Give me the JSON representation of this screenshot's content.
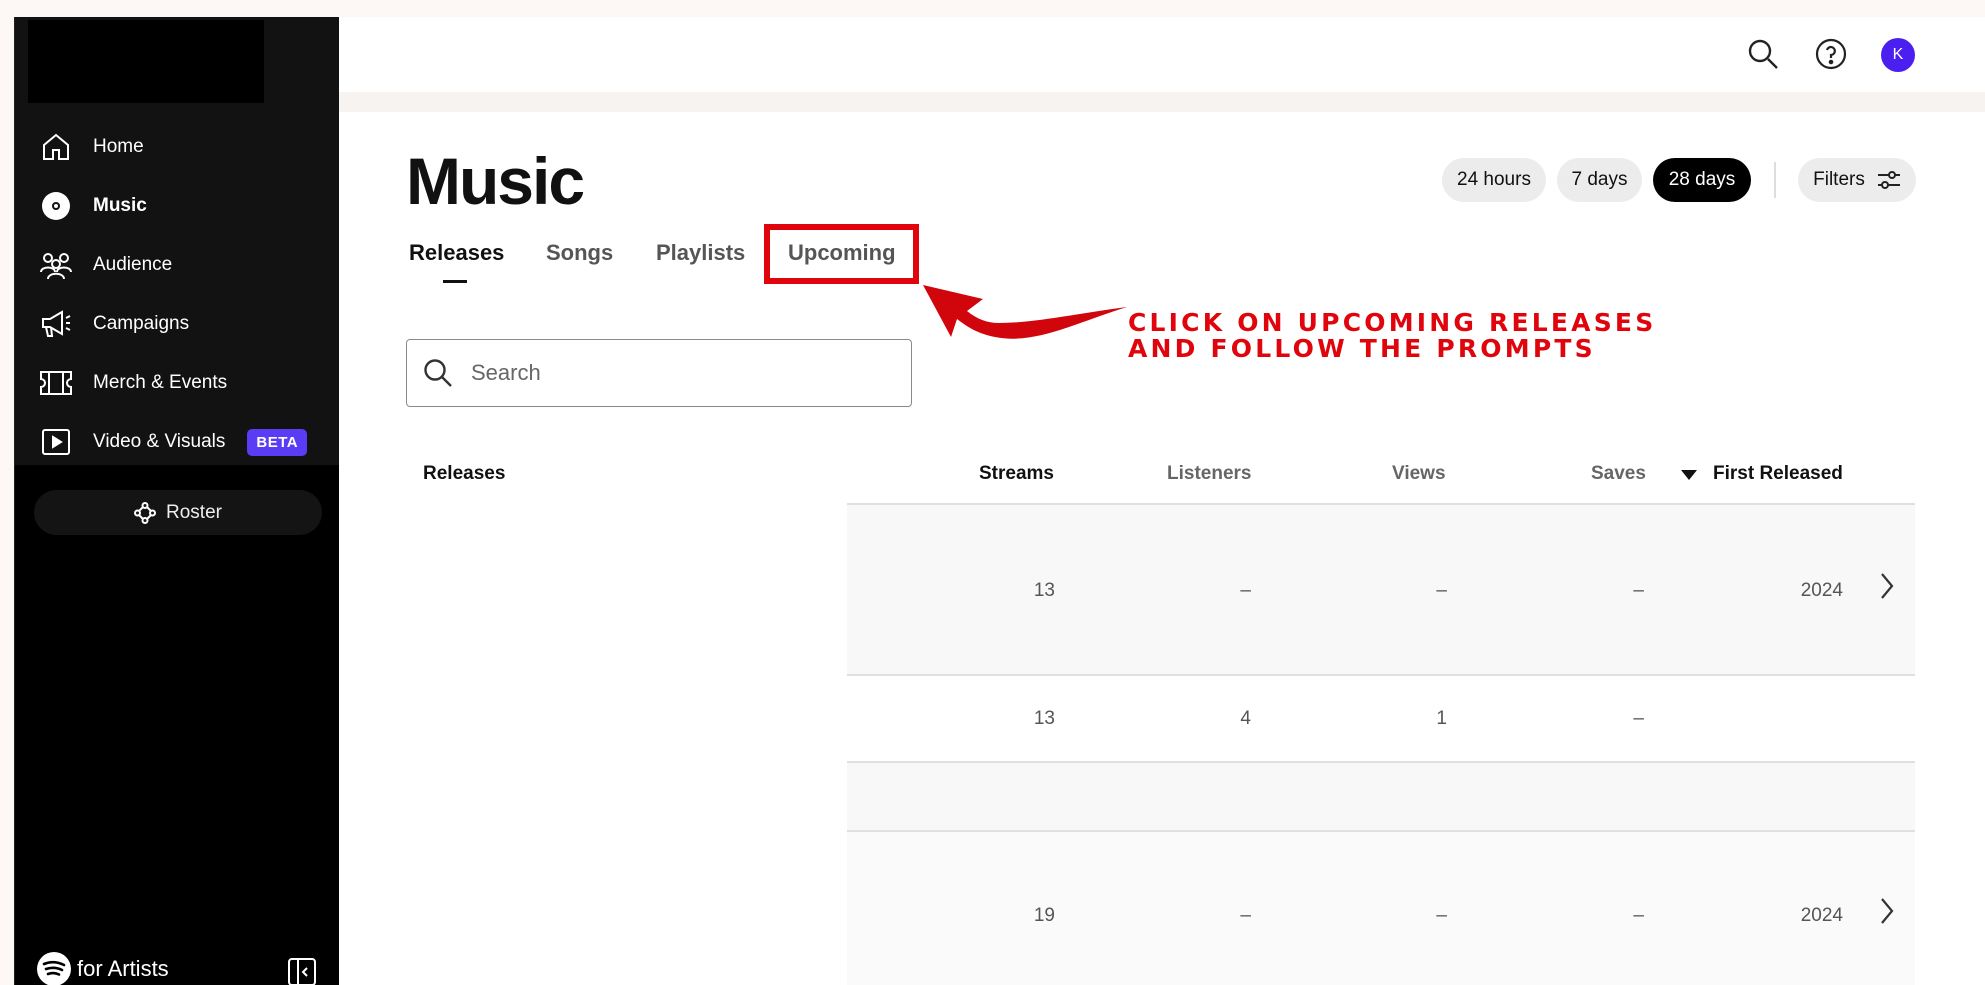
{
  "sidebar": {
    "items": [
      {
        "label": "Home",
        "icon": "home-icon"
      },
      {
        "label": "Music",
        "icon": "disc-icon"
      },
      {
        "label": "Audience",
        "icon": "audience-icon"
      },
      {
        "label": "Campaigns",
        "icon": "megaphone-icon"
      },
      {
        "label": "Merch & Events",
        "icon": "ticket-icon"
      },
      {
        "label": "Video & Visuals",
        "icon": "play-icon",
        "badge": "BETA"
      }
    ],
    "roster_label": "Roster",
    "footer_brand": "for Artists"
  },
  "header": {
    "avatar_initial": "K"
  },
  "main": {
    "title": "Music",
    "time_ranges": [
      "24 hours",
      "7 days",
      "28 days"
    ],
    "selected_range": "28 days",
    "filters_label": "Filters",
    "tabs": [
      "Releases",
      "Songs",
      "Playlists",
      "Upcoming"
    ],
    "active_tab": "Releases",
    "search": {
      "placeholder": "Search"
    },
    "annotation": {
      "line1": "CLICK ON UPCOMING RELEASES",
      "line2": "AND FOLLOW THE PROMPTS",
      "color": "#e0050c"
    },
    "table": {
      "columns": [
        "Releases",
        "Streams",
        "Listeners",
        "Views",
        "Saves",
        "First Released"
      ],
      "rows": [
        {
          "streams": "13",
          "listeners": "–",
          "views": "–",
          "saves": "–",
          "first_released": "2024"
        },
        {
          "streams": "13",
          "listeners": "4",
          "views": "1",
          "saves": "–",
          "first_released": ""
        },
        {
          "streams": "19",
          "listeners": "–",
          "views": "–",
          "saves": "–",
          "first_released": "2024"
        }
      ]
    }
  },
  "colors": {
    "accent": "#5b3cf5",
    "avatar": "#4b1ff0",
    "annotation": "#e0050c"
  }
}
